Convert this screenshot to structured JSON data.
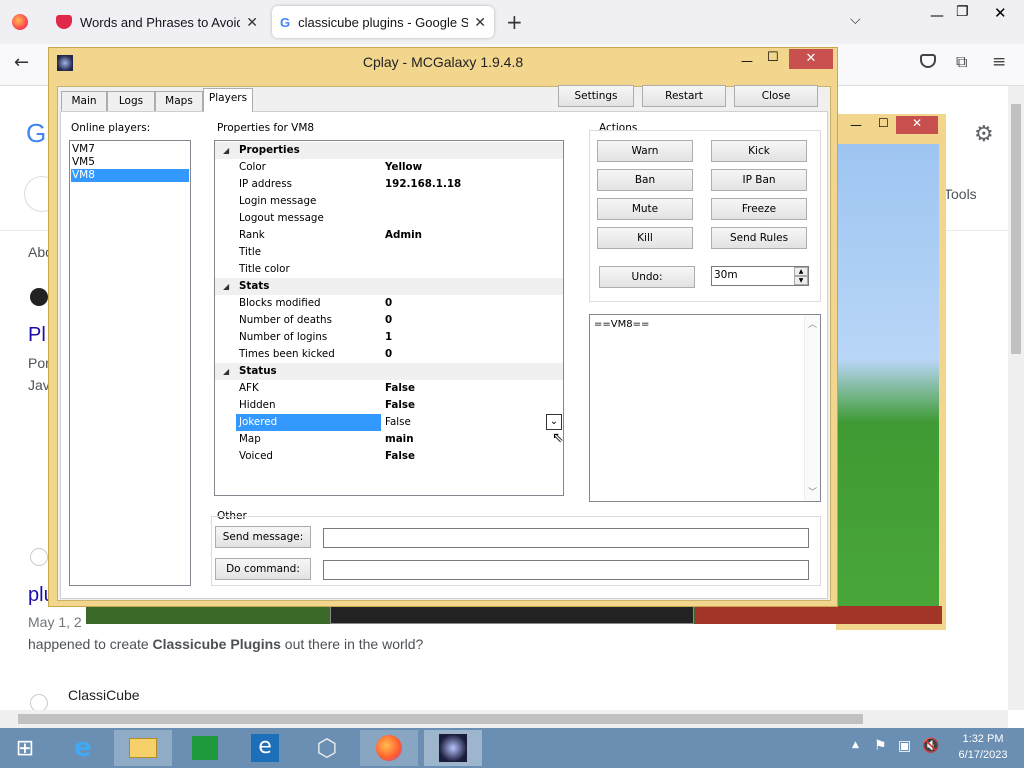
{
  "browser": {
    "tabs": [
      {
        "title": "Words and Phrases to Avoid in",
        "icon": "pocket-icon",
        "color": "#e0284a"
      },
      {
        "title": "classicube plugins - Google Sea",
        "icon": "google-icon"
      }
    ],
    "new_tab": "+",
    "search_bg": {
      "about": "Abo",
      "pl": "Pl",
      "por": "Por",
      "jav": "Jav",
      "tools": "Tools",
      "plu": "plu",
      "date": "May 1, 2",
      "snippet_pre": "happened to create ",
      "snippet_bold": "Classicube Plugins",
      "snippet_post": " out there in the world?",
      "site": "ClassiCube"
    }
  },
  "app": {
    "title": "Cplay - MCGalaxy 1.9.4.8",
    "tabs": [
      "Main",
      "Logs",
      "Maps",
      "Players"
    ],
    "active_tab": "Players",
    "top_buttons": [
      "Settings",
      "Restart",
      "Close"
    ],
    "online_label": "Online players:",
    "players": [
      "VM7",
      "VM5",
      "VM8"
    ],
    "selected_player": "VM8",
    "props_label": "Properties for VM8",
    "categories": [
      {
        "name": "Properties",
        "rows": [
          [
            "Color",
            "Yellow"
          ],
          [
            "IP address",
            "192.168.1.18"
          ],
          [
            "Login message",
            ""
          ],
          [
            "Logout message",
            ""
          ],
          [
            "Rank",
            "Admin"
          ],
          [
            "Title",
            ""
          ],
          [
            "Title color",
            ""
          ]
        ]
      },
      {
        "name": "Stats",
        "rows": [
          [
            "Blocks modified",
            "0"
          ],
          [
            "Number of deaths",
            "0"
          ],
          [
            "Number of logins",
            "1"
          ],
          [
            "Times been kicked",
            "0"
          ]
        ]
      },
      {
        "name": "Status",
        "rows": [
          [
            "AFK",
            "False"
          ],
          [
            "Hidden",
            "False"
          ],
          [
            "Jokered",
            "False"
          ],
          [
            "Map",
            "main"
          ],
          [
            "Voiced",
            "False"
          ]
        ]
      }
    ],
    "selected_prop": "Jokered",
    "actions_label": "Actions",
    "actions": [
      [
        "Warn",
        "Kick"
      ],
      [
        "Ban",
        "IP Ban"
      ],
      [
        "Mute",
        "Freeze"
      ],
      [
        "Kill",
        "Send Rules"
      ]
    ],
    "undo_label": "Undo:",
    "undo_value": "30m",
    "log_text": "==VM8==",
    "other_label": "Other",
    "send_label": "Send message:",
    "cmd_label": "Do command:"
  },
  "taskbar": {
    "time": "1:32 PM",
    "date": "6/17/2023"
  }
}
